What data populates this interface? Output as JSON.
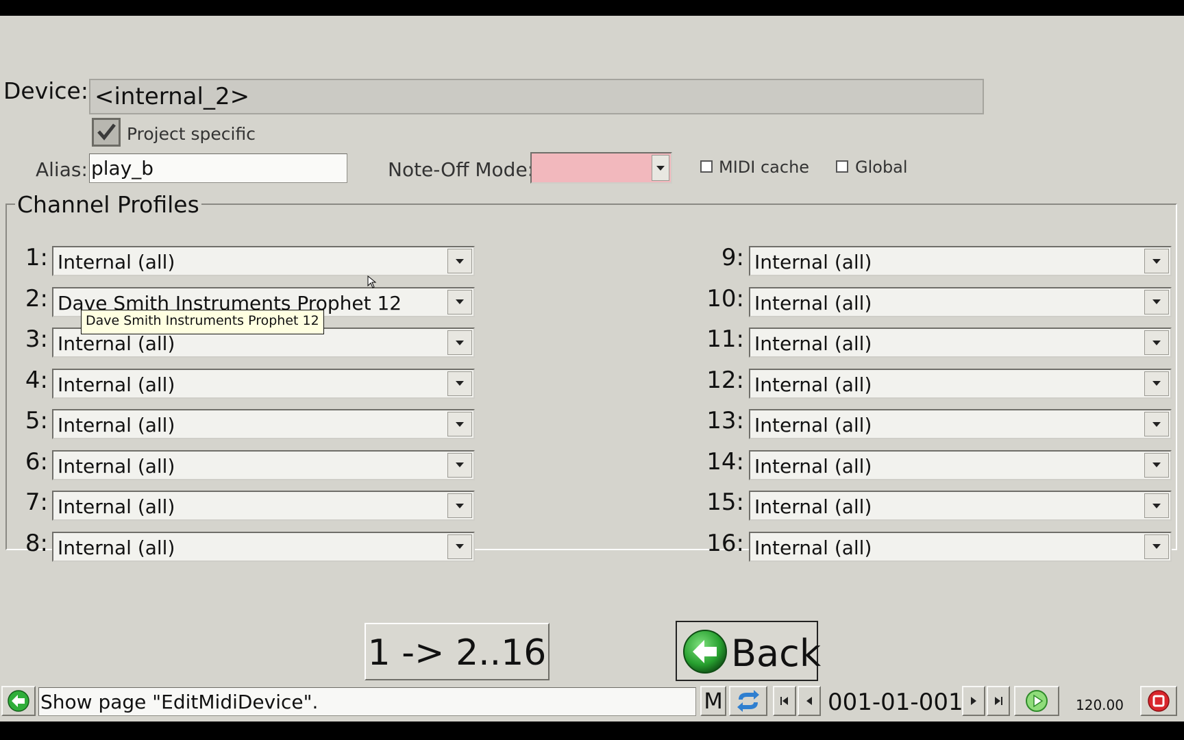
{
  "device": {
    "label": "Device:",
    "value": "<internal_2>"
  },
  "project_specific": {
    "label": "Project specific",
    "checked": true
  },
  "alias": {
    "label": "Alias:",
    "value": "play_b"
  },
  "note_off": {
    "label": "Note-Off Mode:",
    "value": "",
    "accent": "#f2b8bd"
  },
  "midi_cache": {
    "label": "MIDI cache",
    "checked": false
  },
  "global": {
    "label": "Global",
    "checked": false
  },
  "channel_profiles": {
    "title": "Channel Profiles",
    "channels": [
      {
        "num": "1:",
        "value": "Internal (all)"
      },
      {
        "num": "2:",
        "value": "Dave Smith Instruments Prophet 12"
      },
      {
        "num": "3:",
        "value": "Internal (all)"
      },
      {
        "num": "4:",
        "value": "Internal (all)"
      },
      {
        "num": "5:",
        "value": "Internal (all)"
      },
      {
        "num": "6:",
        "value": "Internal (all)"
      },
      {
        "num": "7:",
        "value": "Internal (all)"
      },
      {
        "num": "8:",
        "value": "Internal (all)"
      },
      {
        "num": "9:",
        "value": "Internal (all)"
      },
      {
        "num": "10:",
        "value": "Internal (all)"
      },
      {
        "num": "11:",
        "value": "Internal (all)"
      },
      {
        "num": "12:",
        "value": "Internal (all)"
      },
      {
        "num": "13:",
        "value": "Internal (all)"
      },
      {
        "num": "14:",
        "value": "Internal (all)"
      },
      {
        "num": "15:",
        "value": "Internal (all)"
      },
      {
        "num": "16:",
        "value": "Internal (all)"
      }
    ]
  },
  "tooltip": "Dave Smith Instruments Prophet 12",
  "copy_button": "1 -> 2..16",
  "back_button": "Back",
  "status": {
    "message": "Show page \"EditMidiDevice\".",
    "m_label": "M",
    "position": "001-01-001",
    "tempo": "120.00"
  },
  "colors": {
    "background": "#d5d4cd",
    "accent_green": "#2fae3a",
    "stop_red": "#d9262c"
  }
}
